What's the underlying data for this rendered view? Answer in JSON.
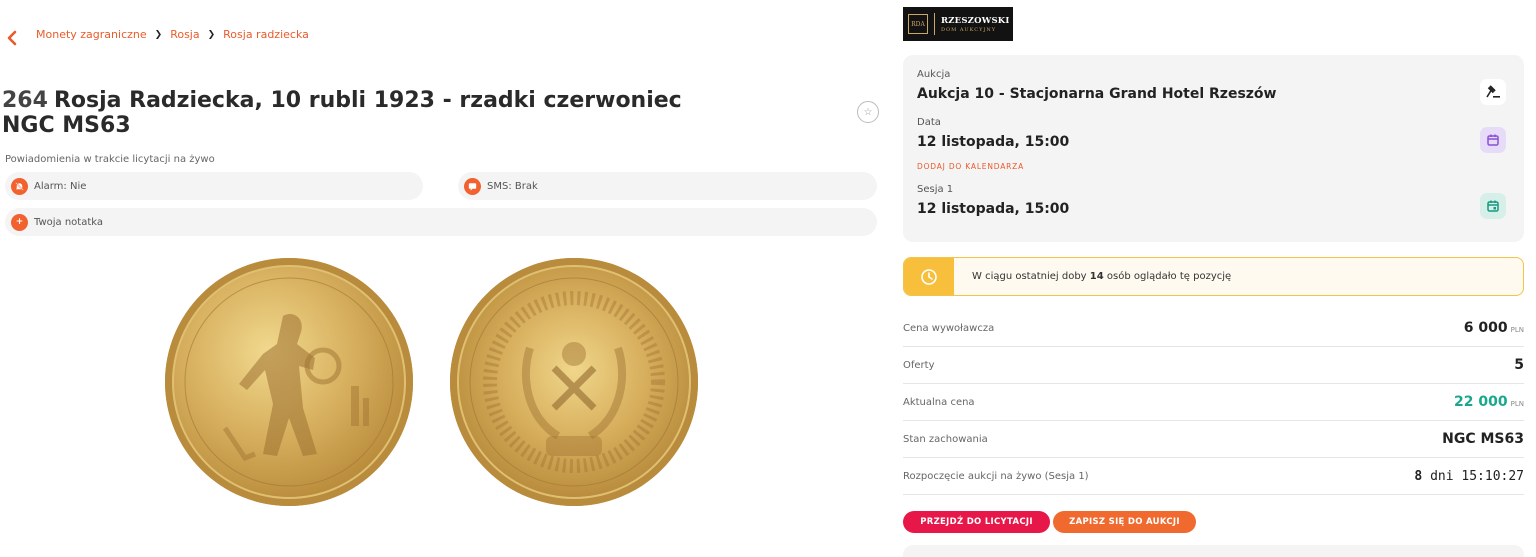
{
  "breadcrumb": {
    "items": [
      "Monety zagraniczne",
      "Rosja",
      "Rosja radziecka"
    ]
  },
  "lot": {
    "number": "264",
    "title": "Rosja Radziecka, 10 rubli 1923 - rzadki czerwoniec NGC MS63"
  },
  "notifications": {
    "label": "Powiadomienia w trakcie licytacji na żywo",
    "alarm": "Alarm: Nie",
    "sms": "SMS: Brak",
    "note": "Twoja notatka"
  },
  "logo": {
    "mark": "RDA",
    "name": "RZESZOWSKI",
    "subtitle": "DOM AUKCYJNY"
  },
  "auction": {
    "auction_label": "Aukcja",
    "auction_name": "Aukcja 10 - Stacjonarna Grand Hotel Rzeszów",
    "date_label": "Data",
    "date_value": "12 listopada, 15:00",
    "add_to_calendar": "DODAJ DO KALENDARZA",
    "session_label": "Sesja 1",
    "session_value": "12 listopada, 15:00"
  },
  "viewers": {
    "prefix": "W ciągu ostatniej doby",
    "count": "14",
    "suffix": "osób oglądało tę pozycję"
  },
  "info": {
    "starting_price_label": "Cena wywoławcza",
    "starting_price": "6 000",
    "currency": "PLN",
    "offers_label": "Oferty",
    "offers": "5",
    "current_price_label": "Aktualna cena",
    "current_price": "22 000",
    "condition_label": "Stan zachowania",
    "condition": "NGC MS63",
    "live_start_label": "Rozpoczęcie aukcji na żywo (Sesja 1)",
    "countdown_days": "8",
    "countdown_rest": "dni 15:10:27"
  },
  "buttons": {
    "bid": "PRZEJDŹ DO LICYTACJI",
    "register": "ZAPISZ SIĘ DO AUKCJI"
  },
  "colors": {
    "accent": "#ea5b2a",
    "bid_button": "#e8174a",
    "register_button": "#f06a2f",
    "current_price": "#1aa88c",
    "banner_border": "#f3c34a"
  }
}
